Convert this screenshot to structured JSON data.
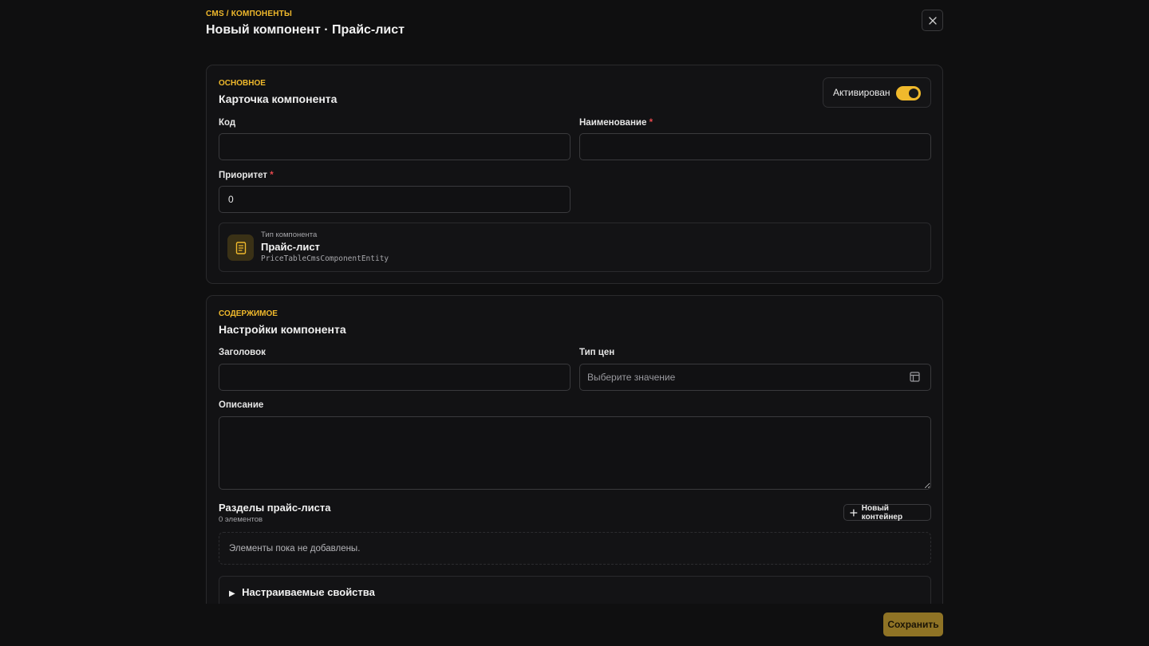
{
  "header": {
    "breadcrumb": "CMS / КОМПОНЕНТЫ",
    "title": "Новый компонент · Прайс-лист",
    "close_icon": "close-icon"
  },
  "basic": {
    "tag": "ОСНОВНОЕ",
    "title": "Карточка компонента",
    "active_label": "Активирован",
    "active": true,
    "code_label": "Код",
    "code_value": "",
    "name_label": "Наименование",
    "name_value": "",
    "priority_label": "Приоритет",
    "priority_value": "0",
    "required_mark": "*",
    "type_caption": "Тип компонента",
    "type_name": "Прайс-лист",
    "type_entity": "PriceTableCmsComponentEntity",
    "type_icon": "document-icon"
  },
  "content": {
    "tag": "СОДЕРЖИМОЕ",
    "title": "Настройки компонента",
    "heading_label": "Заголовок",
    "heading_value": "",
    "price_type_label": "Тип цен",
    "price_type_placeholder": "Выберите значение",
    "description_label": "Описание",
    "description_value": "",
    "sections_title": "Разделы прайс-листа",
    "sections_count": "0 элементов",
    "new_container_label": "Новый контейнер",
    "empty_text": "Элементы пока не добавлены.",
    "custom_props_label": "Настраиваемые свойства"
  },
  "footer": {
    "save_label": "Сохранить"
  },
  "colors": {
    "accent": "#f0b92c",
    "background": "#0f0f10",
    "card": "#121214",
    "required": "#e5484d"
  }
}
